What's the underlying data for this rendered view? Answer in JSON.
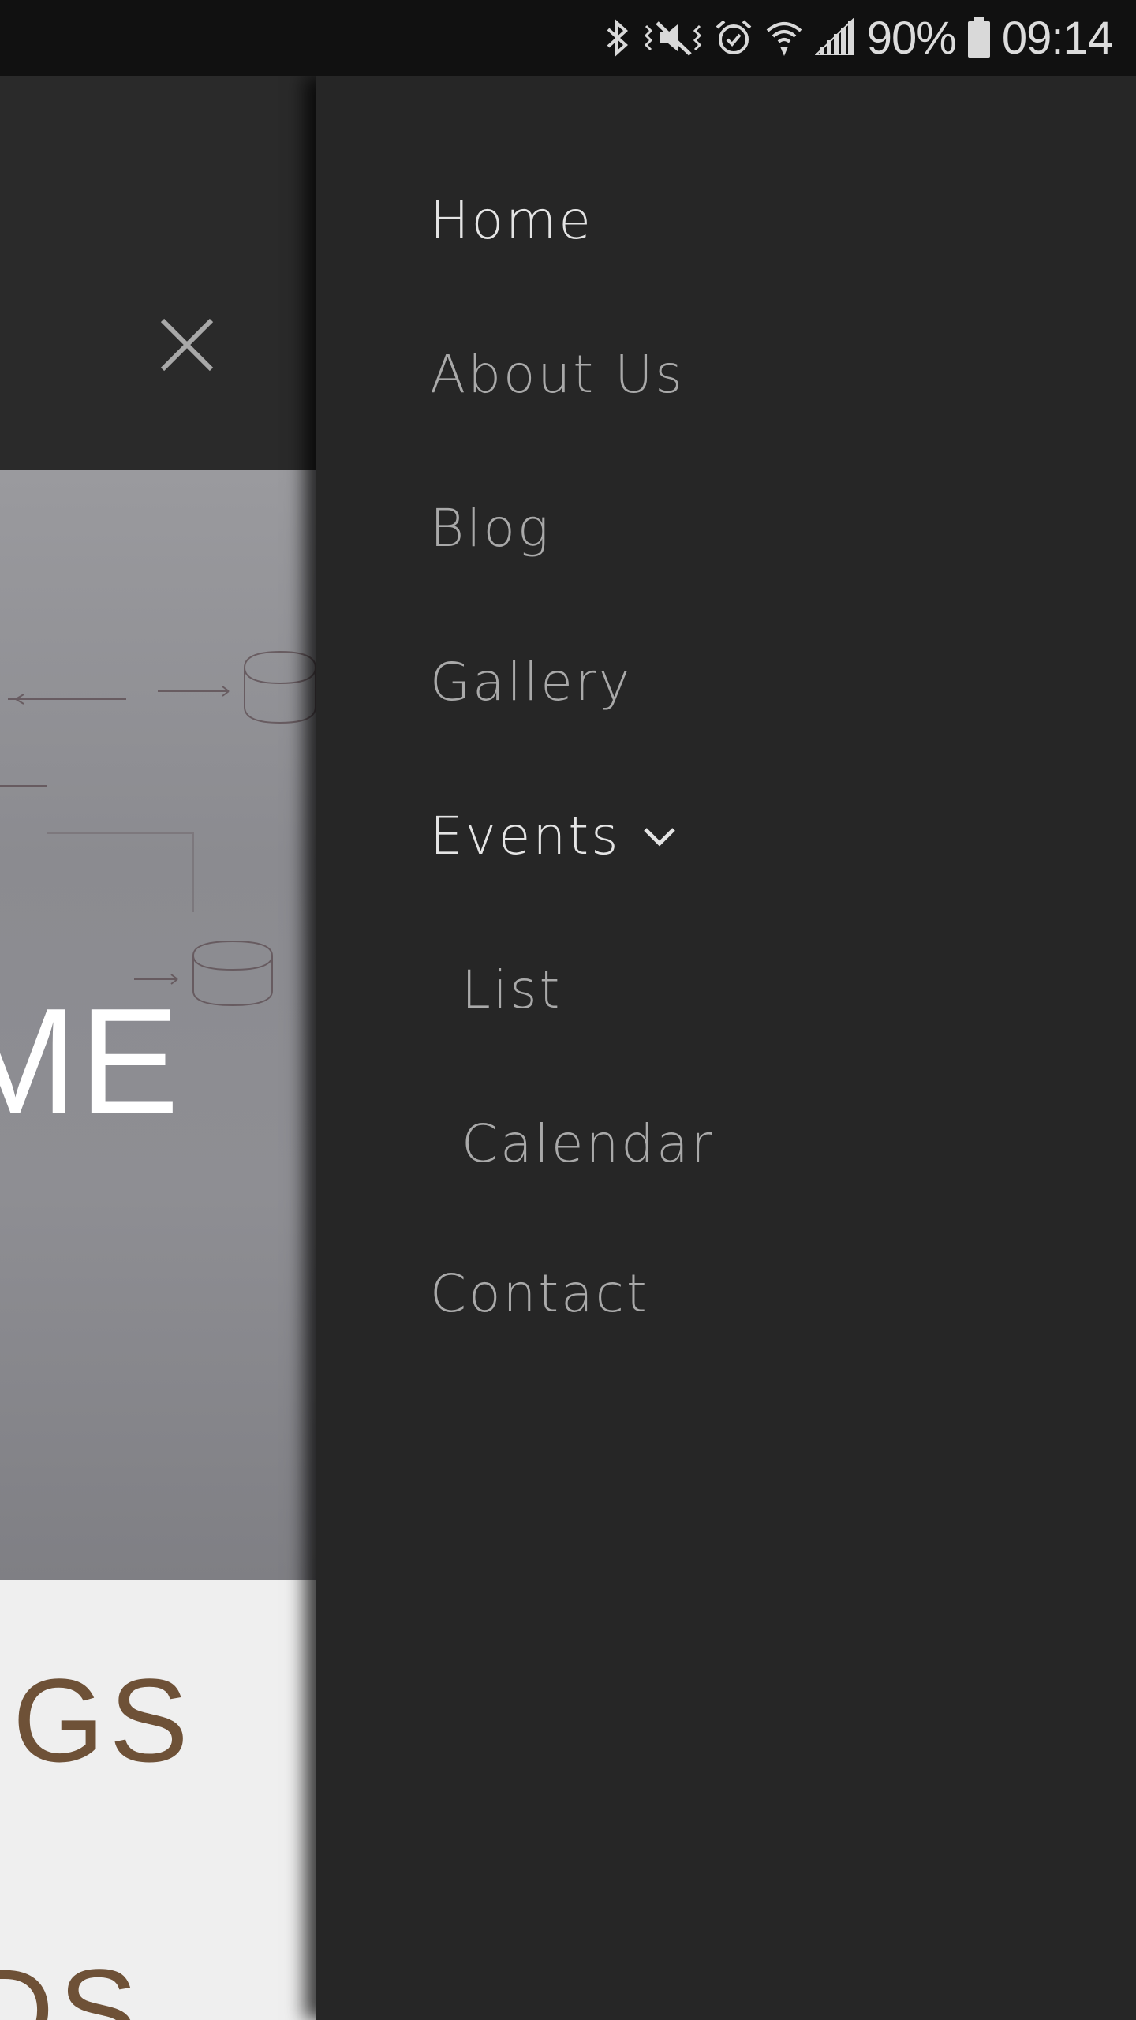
{
  "status_bar": {
    "battery_percent": "90%",
    "time": "09:14",
    "icons": [
      "bluetooth-icon",
      "vibrate-mute-icon",
      "alarm-icon",
      "wifi-icon",
      "signal-icon",
      "battery-icon"
    ]
  },
  "background_page": {
    "hero_text": "ME",
    "section_text": "GS",
    "section_text_2": "DS"
  },
  "drawer": {
    "items": [
      {
        "label": "Home"
      },
      {
        "label": "About Us"
      },
      {
        "label": "Blog"
      },
      {
        "label": "Gallery"
      },
      {
        "label": "Events"
      },
      {
        "label": "List"
      },
      {
        "label": "Calendar"
      },
      {
        "label": "Contact"
      }
    ]
  },
  "colors": {
    "drawer_bg": "#262626",
    "status_bar_bg": "#111111",
    "active_text": "#e4e4e4",
    "inactive_text": "#a9a9a9",
    "accent_brown": "#6e5137"
  }
}
